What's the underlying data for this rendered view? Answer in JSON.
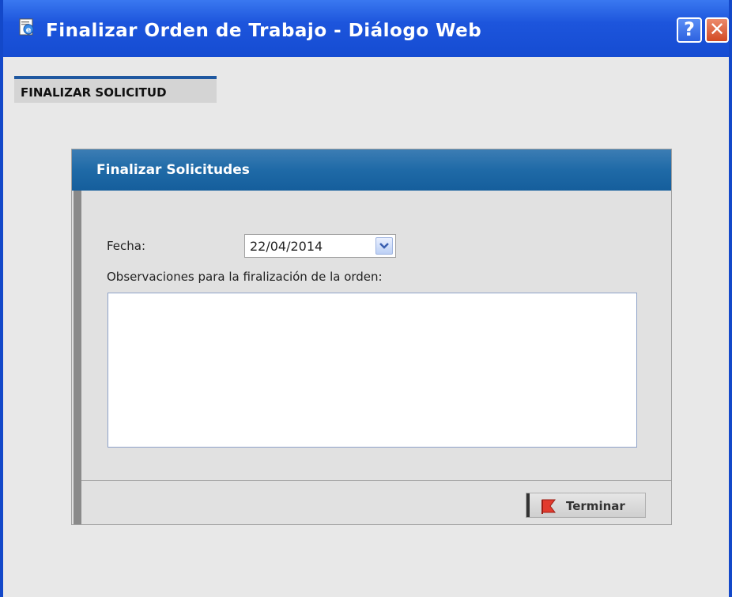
{
  "window": {
    "title": "Finalizar Orden de Trabajo - Diálogo Web",
    "help_label": "?",
    "close_label": "✕"
  },
  "tab": {
    "label": "FINALIZAR SOLICITUD"
  },
  "panel": {
    "title": "Finalizar Solicitudes",
    "fecha_label": "Fecha:",
    "fecha_value": "22/04/2014",
    "observaciones_label": "Observaciones para la firalización de la orden:",
    "observaciones_value": "",
    "terminar_label": "Terminar"
  },
  "colors": {
    "titlebar": "#1f58e0",
    "panel_header": "#1f6aa7",
    "tab_accent": "#1f58a0"
  },
  "icons": {
    "title": "ie-document-icon",
    "date_dropdown": "chevron-down-icon",
    "terminar": "red-pin-icon"
  }
}
